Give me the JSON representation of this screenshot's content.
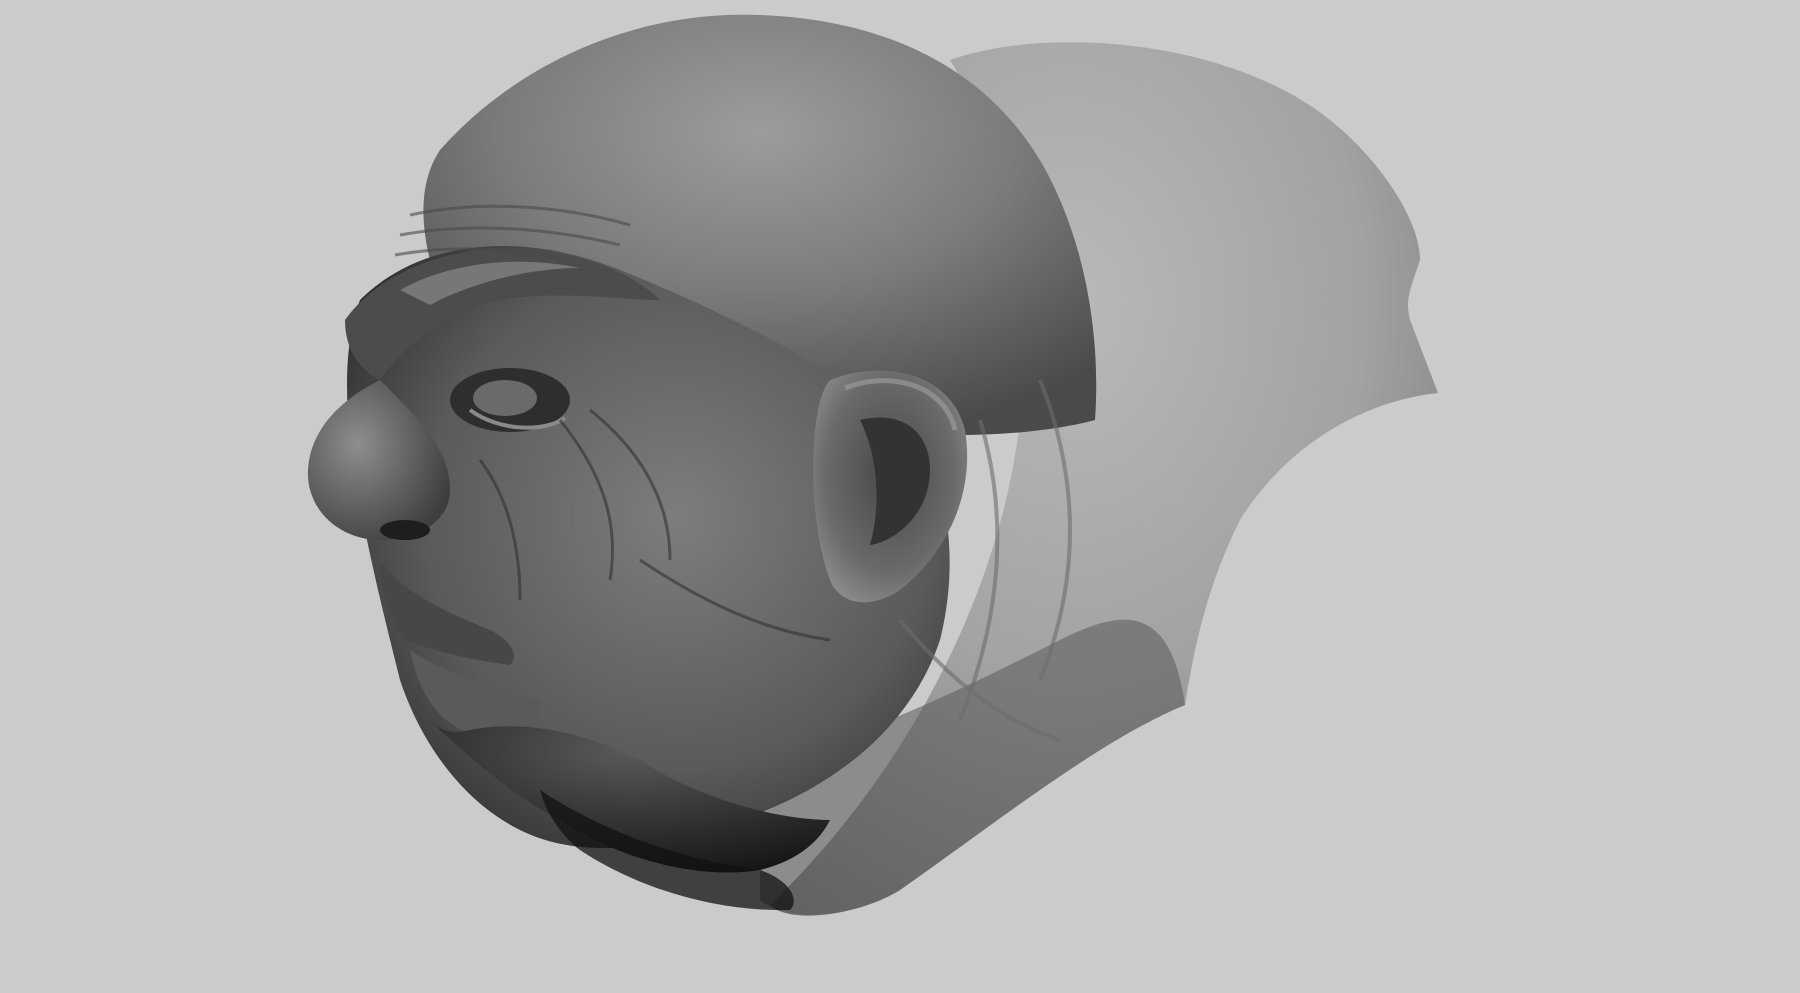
{
  "viewport": {
    "background_color": "#cbcbcb",
    "model": {
      "description_icon": "sculpted-head-icon",
      "material_color": "#7a7a7a",
      "highlight_color": "#b4b4b4",
      "shadow_color": "#1c1c1c"
    }
  }
}
